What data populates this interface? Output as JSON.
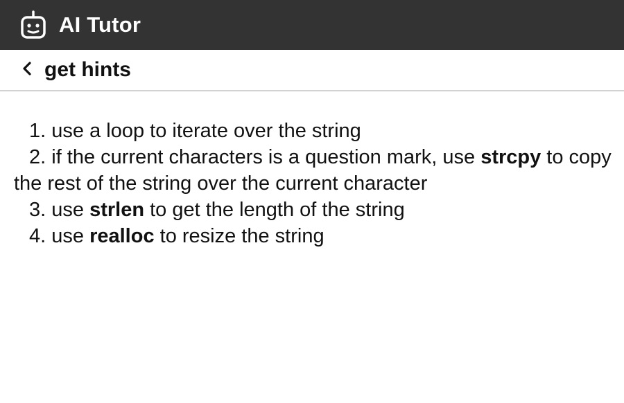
{
  "app": {
    "title": "AI Tutor",
    "logo_icon": "robot-face-icon"
  },
  "header": {
    "back_icon": "chevron-left-icon",
    "title": "get hints"
  },
  "hints": [
    {
      "number": "1.",
      "pre": " use a loop to iterate over the string",
      "bold": "",
      "post": ""
    },
    {
      "number": "2.",
      "pre": "if the current characters is a question mark, use ",
      "bold": "strcpy",
      "post": " to copy the rest of the string over the current character"
    },
    {
      "number": "3.",
      "pre": "use ",
      "bold": "strlen",
      "post": " to get the length of the string"
    },
    {
      "number": "4.",
      "pre": "use ",
      "bold": "realloc",
      "post": " to resize the string"
    }
  ],
  "colors": {
    "topbar": "#333333",
    "divider": "#d2d2d2",
    "text": "#111111"
  }
}
